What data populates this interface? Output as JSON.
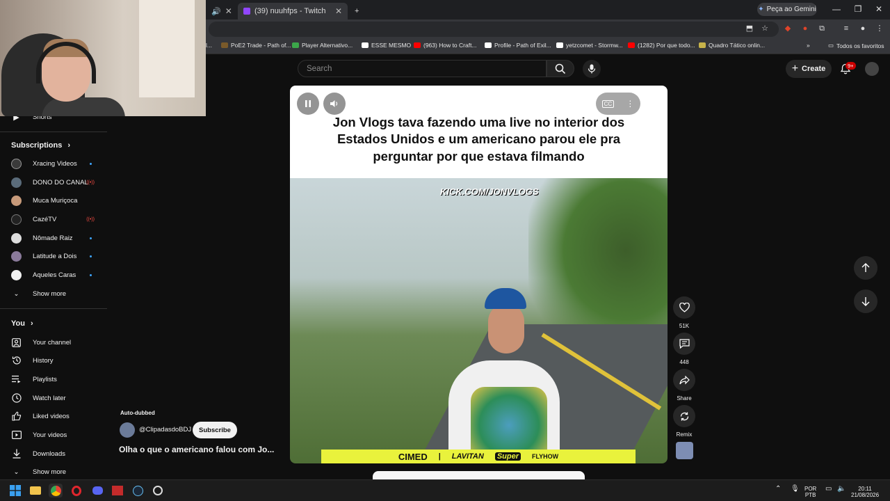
{
  "browser": {
    "tabs": [
      {
        "label": "",
        "active": false
      },
      {
        "label": "(39) nuuhfps - Twitch",
        "active": true
      }
    ],
    "new_tab_symbol": "+",
    "gemini_label": "Peça ao Gemini",
    "bookmarks": [
      {
        "label": "PoE2 Trade - Path of...",
        "color": "#7a5a2a"
      },
      {
        "label": "Player Alternativo...",
        "color": "#3ca64a"
      },
      {
        "label": "ESSE MESMO",
        "color": "#ffffff"
      },
      {
        "label": "(963) How to Craft...",
        "color": "#ff0000"
      },
      {
        "label": "Profile - Path of Exil...",
        "color": "#ffffff"
      },
      {
        "label": "yetzcomet - Stormw...",
        "color": "#ffffff"
      },
      {
        "label": "(1282) Por que todo...",
        "color": "#ff0000"
      },
      {
        "label": "Quadro Tático onlin...",
        "color": "#c7b34a"
      }
    ],
    "all_bookmarks_label": "Todos os favoritos",
    "partial_bookmark_label": "l..."
  },
  "youtube": {
    "search_placeholder": "Search",
    "create_label": "Create",
    "notification_count": "9+",
    "sidebar": {
      "partial_item": "Shorts",
      "subscriptions_title": "Subscriptions",
      "subscriptions": [
        {
          "label": "Xracing Videos",
          "indicator": "dot",
          "color": "#3a3a3a"
        },
        {
          "label": "DONO DO CANAL",
          "indicator": "live",
          "color": "#5a6b7a"
        },
        {
          "label": "Muca Muriçoca",
          "indicator": "none",
          "color": "#c79a7a"
        },
        {
          "label": "CazéTV",
          "indicator": "live",
          "color": "#222222"
        },
        {
          "label": "Nômade Raiz",
          "indicator": "dot",
          "color": "#dddddd"
        },
        {
          "label": "Latitude a Dois",
          "indicator": "dot",
          "color": "#8a7a9a"
        },
        {
          "label": "Aqueles Caras",
          "indicator": "dot",
          "color": "#f0f0f0"
        }
      ],
      "show_more_1": "Show more",
      "you_title": "You",
      "you_items": [
        {
          "label": "Your channel",
          "icon": "user-box-icon"
        },
        {
          "label": "History",
          "icon": "history-icon"
        },
        {
          "label": "Playlists",
          "icon": "playlist-icon"
        },
        {
          "label": "Watch later",
          "icon": "clock-icon"
        },
        {
          "label": "Liked videos",
          "icon": "thumbs-up-icon"
        },
        {
          "label": "Your videos",
          "icon": "video-icon"
        },
        {
          "label": "Downloads",
          "icon": "download-icon"
        }
      ],
      "show_more_2": "Show more"
    },
    "short": {
      "caption": "Jon Vlogs tava fazendo uma live no interior dos Estados Unidos e um americano parou ele pra perguntar por que estava filmando",
      "watermark": "KICK.COM/JONVLOGS",
      "sponsors": [
        "CIMED",
        "|",
        "LAVITAN",
        "Super",
        "FLYHOW"
      ],
      "auto_dubbed": "Auto-dubbed",
      "channel": "@ClipadasdoBDJ",
      "subscribe_label": "Subscribe",
      "title": "Olha o que o americano falou com Jo...",
      "likes": "51K",
      "comments": "448",
      "share_label": "Share",
      "remix_label": "Remix"
    }
  },
  "taskbar": {
    "language": "POR",
    "layout": "PTB",
    "time": "20:11",
    "date": "21/08/2026"
  }
}
